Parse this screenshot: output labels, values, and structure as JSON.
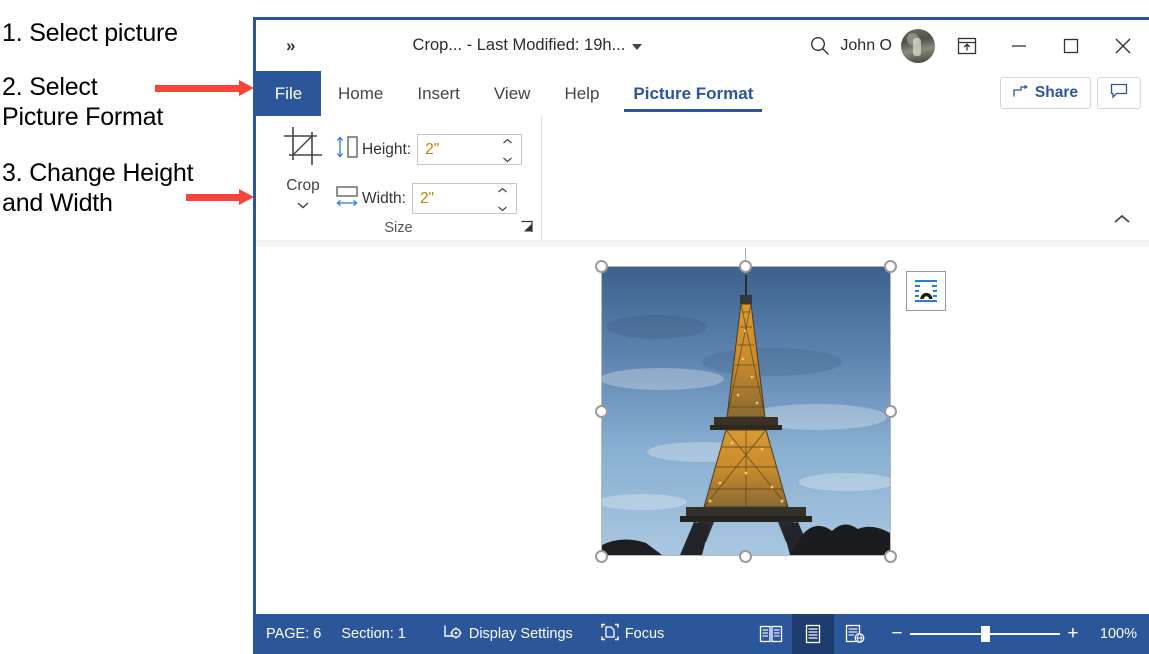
{
  "instructions": [
    {
      "id": "step-1",
      "text": "1. Select picture"
    },
    {
      "id": "step-2",
      "text": "2. Select\n    Picture Format"
    },
    {
      "id": "step-3",
      "text": "3. Change Height\n    and Width"
    }
  ],
  "annotations": {
    "arrow_color": "#f8453c",
    "arrow_1_target": "Picture Format tab",
    "arrow_2_target": "Height and Width boxes"
  },
  "window": {
    "accent_color": "#2b579a",
    "title_bar": {
      "quick_access_more": "»",
      "document_title": "Crop...  -  Last Modified: 19h...",
      "title_dropdown_icon": "chevron-down-icon",
      "search_icon": "search-icon",
      "account_name": "John O",
      "avatar_icon": "user-avatar",
      "ribbon_display_options_icon": "ribbon-display-options-icon",
      "minimize_icon": "minimize-icon",
      "maximize_icon": "maximize-icon",
      "close_icon": "close-icon"
    },
    "tabs": {
      "file_label": "File",
      "items": [
        {
          "label": "Home",
          "active": false
        },
        {
          "label": "Insert",
          "active": false
        },
        {
          "label": "View",
          "active": false
        },
        {
          "label": "Help",
          "active": false
        },
        {
          "label": "Picture Format",
          "active": true
        }
      ],
      "share_label": "Share",
      "share_icon": "share-icon",
      "comments_icon": "comment-icon"
    },
    "ribbon": {
      "group_label": "Size",
      "crop": {
        "label": "Crop",
        "icon": "crop-icon",
        "dropdown_icon": "chevron-down-icon"
      },
      "height": {
        "label": "Height:",
        "value": "2\"",
        "icon": "height-arrows-icon"
      },
      "width": {
        "label": "Width:",
        "value": "2\"",
        "icon": "width-arrows-icon"
      },
      "dialog_launcher_icon": "dialog-launcher-icon",
      "collapse_ribbon_icon": "chevron-up-icon"
    },
    "document": {
      "picture": {
        "name": "eiffel-tower-photo",
        "selected": true,
        "handle_count": 8,
        "rotation_handle": true,
        "layout_options_icon": "layout-options-icon"
      }
    },
    "status_bar": {
      "page_label": "PAGE: 6",
      "section_label": "Section: 1",
      "display_settings_label": "Display Settings",
      "display_settings_icon": "display-settings-icon",
      "focus_label": "Focus",
      "focus_icon": "focus-icon",
      "view_buttons": [
        {
          "name": "read-mode",
          "icon": "read-mode-icon",
          "active": false
        },
        {
          "name": "print-layout",
          "icon": "print-layout-icon",
          "active": true
        },
        {
          "name": "web-layout",
          "icon": "web-layout-icon",
          "active": false
        }
      ],
      "zoom_out_label": "−",
      "zoom_in_label": "+",
      "zoom_level": "100%"
    }
  }
}
